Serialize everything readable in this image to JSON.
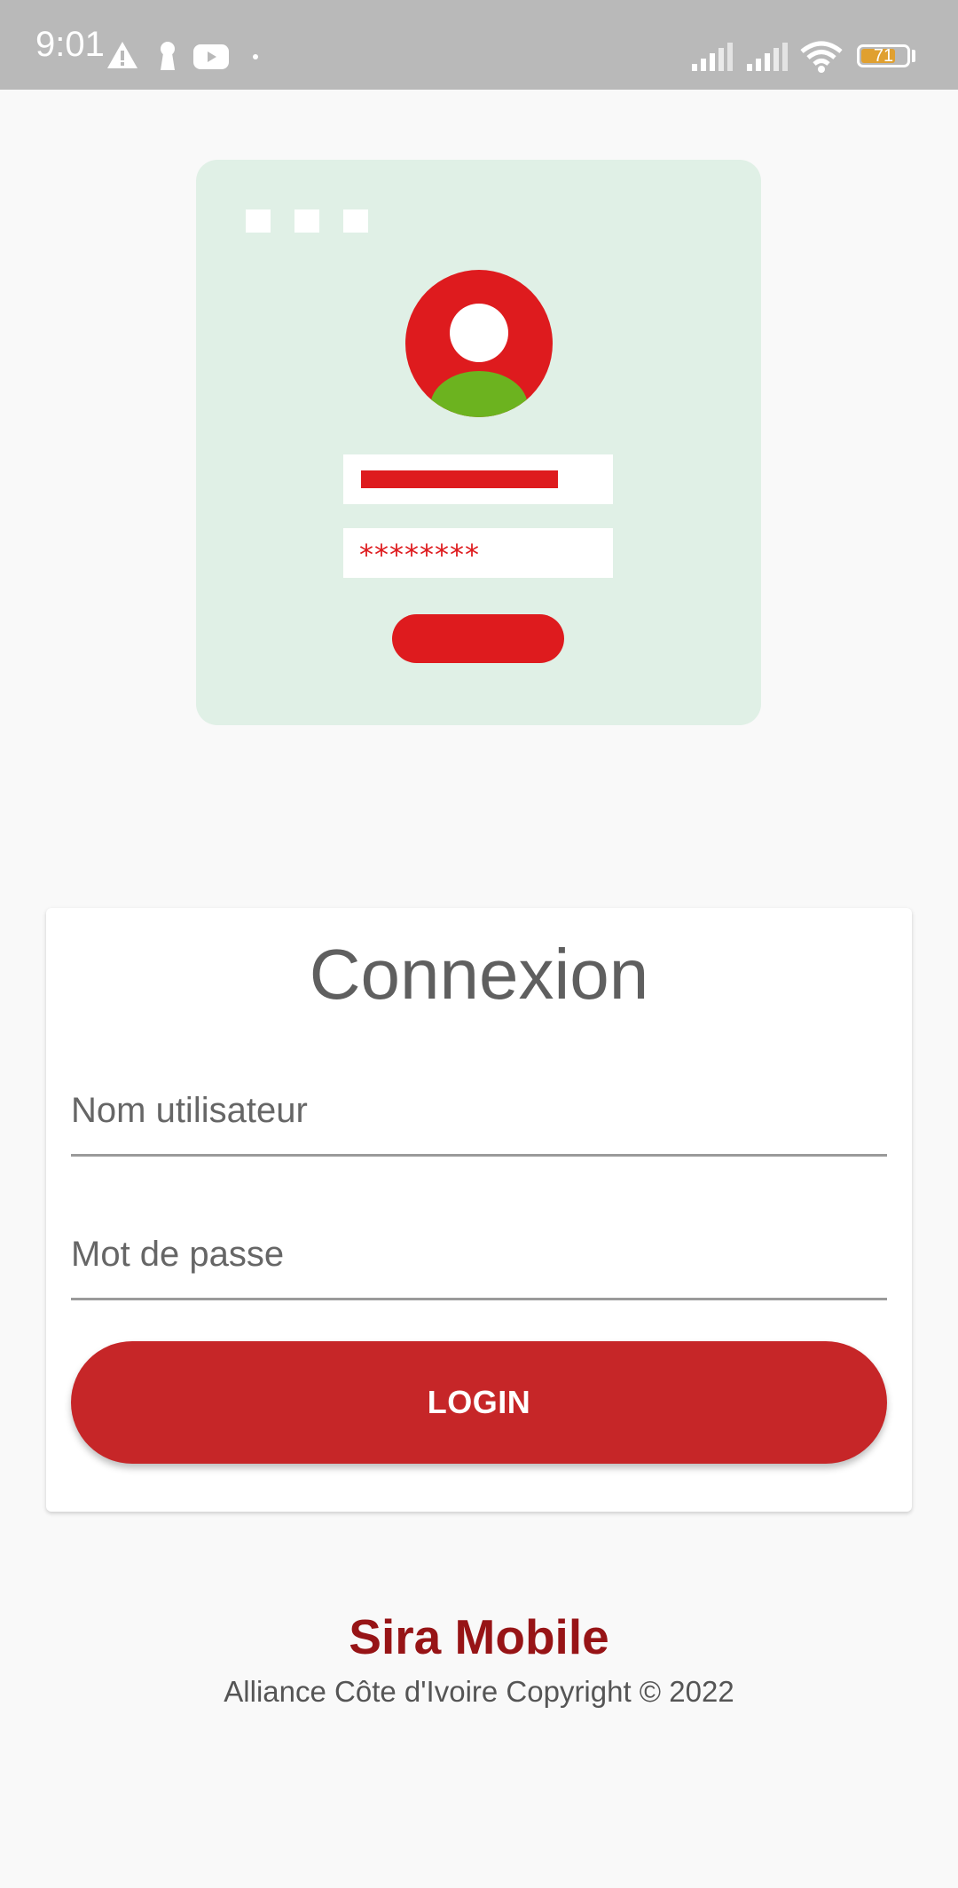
{
  "status_bar": {
    "time": "9:01",
    "battery_level": "71",
    "left_icons": [
      "warning-icon",
      "keyhole-icon",
      "youtube-icon",
      "dot-icon"
    ],
    "right_icons": [
      "signal-icon",
      "signal-icon",
      "wifi-icon",
      "battery-icon"
    ]
  },
  "illustration": {
    "password_mask": "********"
  },
  "login_card": {
    "title": "Connexion",
    "username_placeholder": "Nom utilisateur",
    "password_placeholder": "Mot de passe",
    "login_label": "LOGIN"
  },
  "footer": {
    "brand": "Sira Mobile",
    "copyright": "Alliance Côte d'Ivoire Copyright © 2022"
  },
  "colors": {
    "status_bar_bg": "#b9b9b9",
    "primary_red": "#c62628",
    "illustration_bg": "#e0f0e6",
    "illustration_red": "#de1b1e",
    "avatar_green": "#6cb31f",
    "brand_text": "#971416",
    "battery_fill": "#e0a030"
  }
}
